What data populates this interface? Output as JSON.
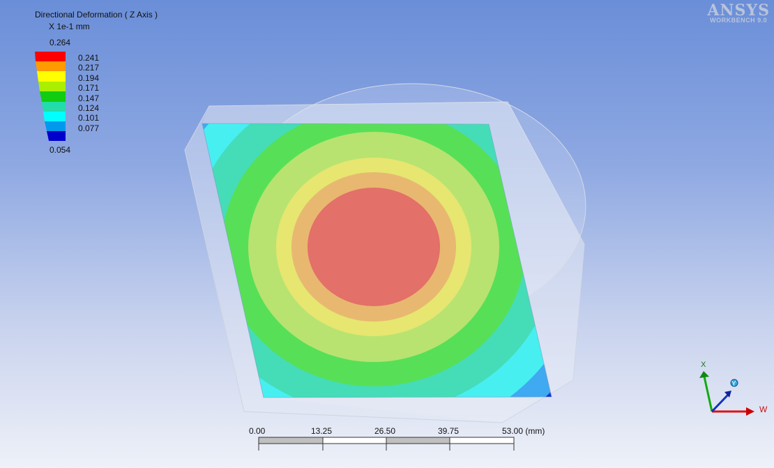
{
  "legend": {
    "title": "Directional Deformation ( Z Axis )",
    "units": "X 1e-1 mm",
    "max": "0.264",
    "min": "0.054",
    "bands": [
      {
        "label": "0.241",
        "color": "#ff0000"
      },
      {
        "label": "0.217",
        "color": "#ff9a00"
      },
      {
        "label": "0.194",
        "color": "#ffff00"
      },
      {
        "label": "0.171",
        "color": "#aaee00"
      },
      {
        "label": "0.147",
        "color": "#11cc11"
      },
      {
        "label": "0.124",
        "color": "#22ddaa"
      },
      {
        "label": "0.101",
        "color": "#00ffff"
      },
      {
        "label": "0.077",
        "color": "#0099ee"
      },
      {
        "label": "",
        "color": "#0000cc"
      }
    ]
  },
  "logo": {
    "main": "ANSYS",
    "sub": "WORKBENCH 9.0"
  },
  "scale_bar": {
    "labels": [
      "0.00",
      "13.25",
      "26.50",
      "39.75",
      "53.00 (mm)"
    ]
  },
  "triad": {
    "x_label": "X",
    "y_label": "Y",
    "w_label": "W"
  },
  "colors": {
    "contour_max": "#e06058",
    "contour_outer": "#2288ff",
    "corner": "#1133cc"
  }
}
